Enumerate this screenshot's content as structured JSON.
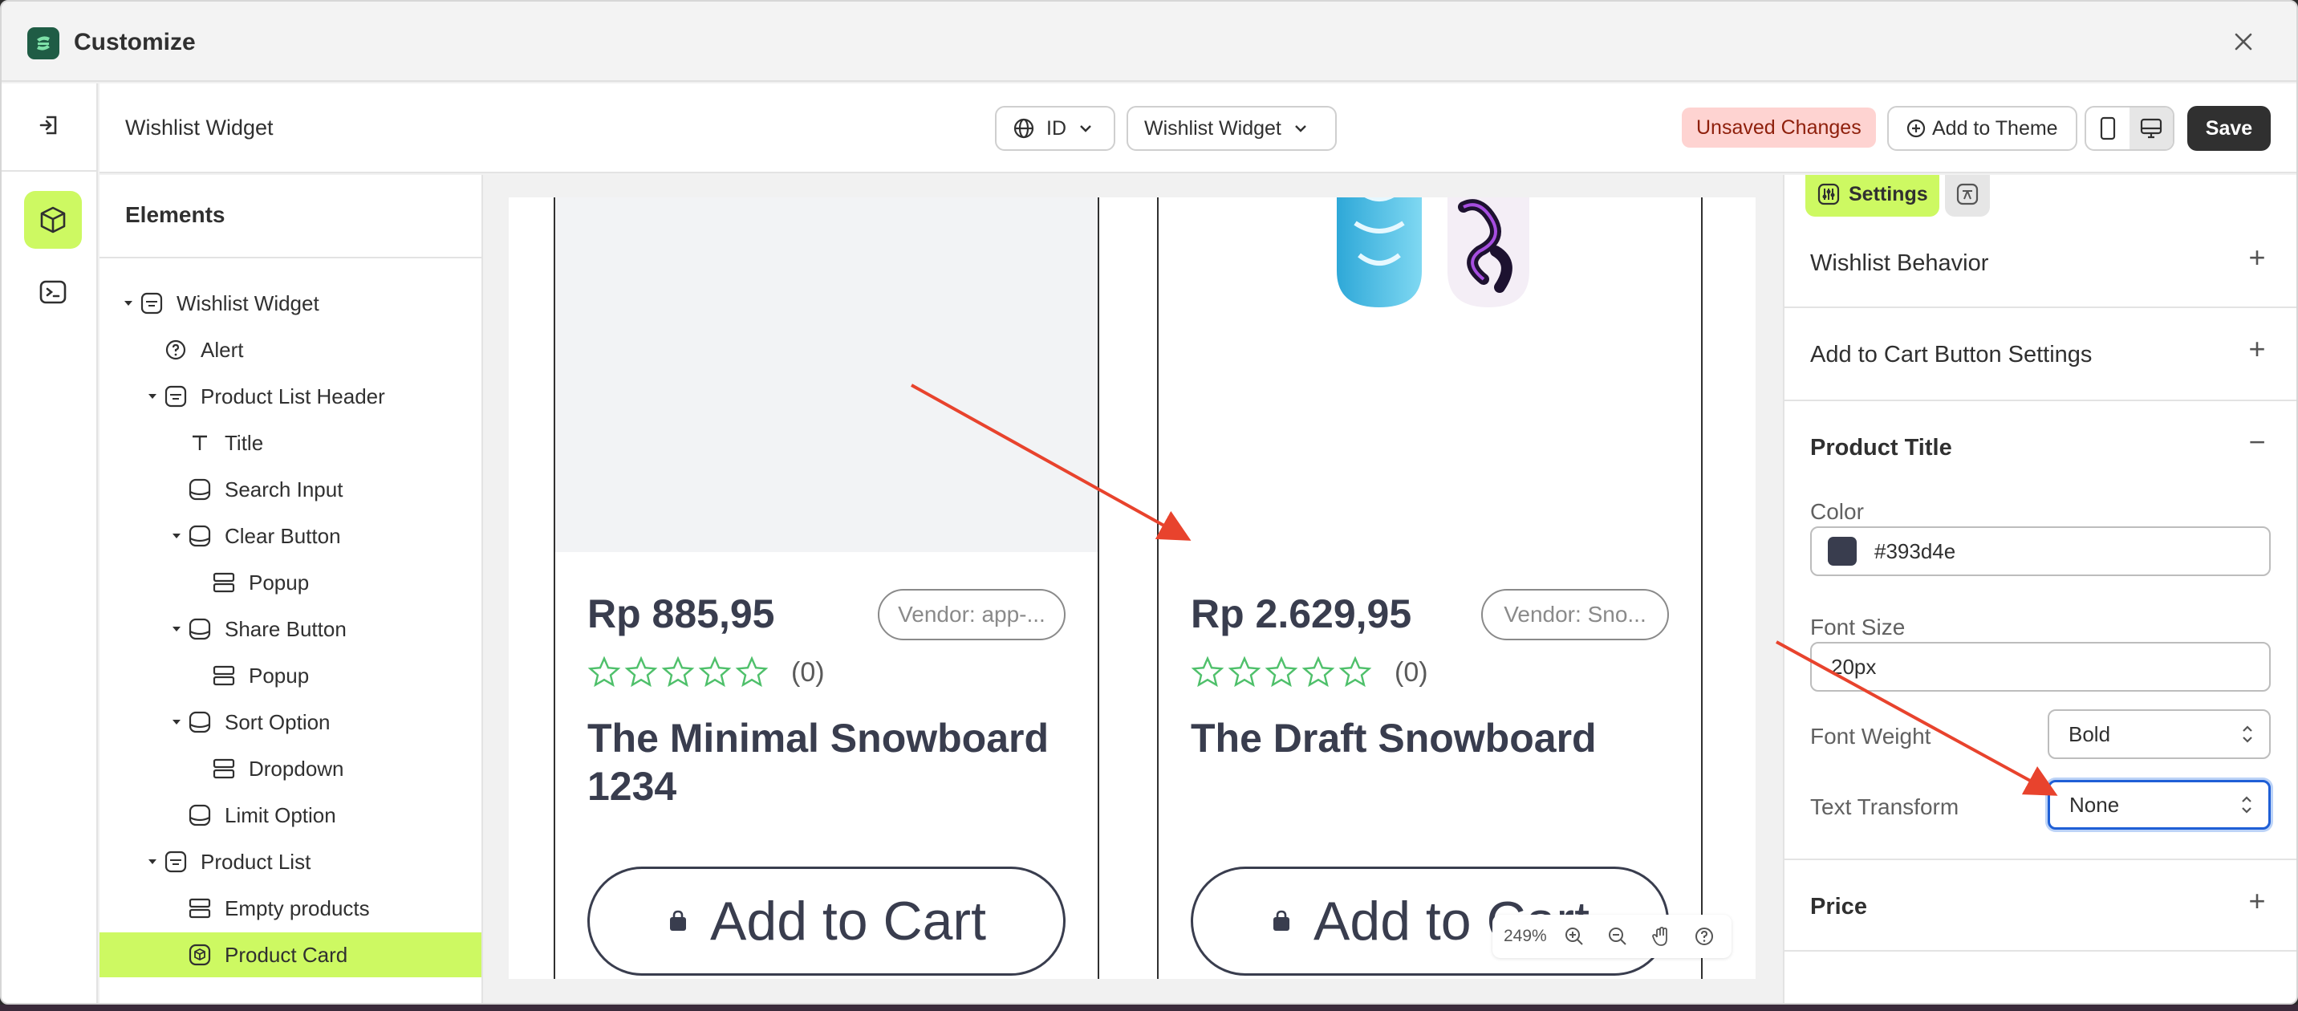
{
  "window": {
    "title": "Customize"
  },
  "topbar": {
    "page_name": "Wishlist Widget",
    "language": "ID",
    "template": "Wishlist Widget",
    "unsaved": "Unsaved Changes",
    "add_to_theme": "Add to Theme",
    "save": "Save"
  },
  "elements": {
    "title": "Elements",
    "tree": [
      {
        "label": "Wishlist Widget",
        "icon": "widget-icon",
        "caret": true,
        "selected": false
      },
      {
        "label": "Alert",
        "icon": "help-circle-icon",
        "caret": false,
        "selected": false
      },
      {
        "label": "Product List Header",
        "icon": "widget-icon",
        "caret": true,
        "selected": false
      },
      {
        "label": "Title",
        "icon": "text-icon",
        "caret": false,
        "selected": false
      },
      {
        "label": "Search Input",
        "icon": "block-icon",
        "caret": false,
        "selected": false
      },
      {
        "label": "Clear Button",
        "icon": "block-icon",
        "caret": true,
        "selected": false
      },
      {
        "label": "Popup",
        "icon": "rows-icon",
        "caret": false,
        "selected": false
      },
      {
        "label": "Share Button",
        "icon": "block-icon",
        "caret": true,
        "selected": false
      },
      {
        "label": "Popup",
        "icon": "rows-icon",
        "caret": false,
        "selected": false
      },
      {
        "label": "Sort Option",
        "icon": "block-icon",
        "caret": true,
        "selected": false
      },
      {
        "label": "Dropdown",
        "icon": "rows-icon",
        "caret": false,
        "selected": false
      },
      {
        "label": "Limit Option",
        "icon": "block-icon",
        "caret": false,
        "selected": false
      },
      {
        "label": "Product List",
        "icon": "widget-icon",
        "caret": true,
        "selected": false
      },
      {
        "label": "Empty products",
        "icon": "rows-icon",
        "caret": false,
        "selected": false
      },
      {
        "label": "Product Card",
        "icon": "cube-block-icon",
        "caret": false,
        "selected": true
      }
    ]
  },
  "preview": {
    "cards": [
      {
        "price": "Rp 885,95",
        "vendor": "Vendor: app-...",
        "rating_count": "(0)",
        "title": "The Minimal Snowboard 1234",
        "button": "Add to Cart"
      },
      {
        "price": "Rp 2.629,95",
        "vendor": "Vendor: Sno...",
        "rating_count": "(0)",
        "title": "The Draft Snowboard",
        "button": "Add to Cart"
      }
    ],
    "zoom": "249%"
  },
  "settings": {
    "tab_label": "Settings",
    "sections": {
      "wishlist_behavior": "Wishlist Behavior",
      "add_to_cart": "Add to Cart Button Settings",
      "product_title": "Product Title",
      "price": "Price"
    },
    "color_label": "Color",
    "color_value": "#393d4e",
    "font_size_label": "Font Size",
    "font_size_value": "20px",
    "font_weight_label": "Font Weight",
    "font_weight_value": "Bold",
    "text_transform_label": "Text Transform",
    "text_transform_value": "None"
  },
  "colors": {
    "accent": "#cdf962",
    "title_color": "#393d4e",
    "annotation_arrow": "#e8432d",
    "focus_ring": "#1f5fd6"
  }
}
